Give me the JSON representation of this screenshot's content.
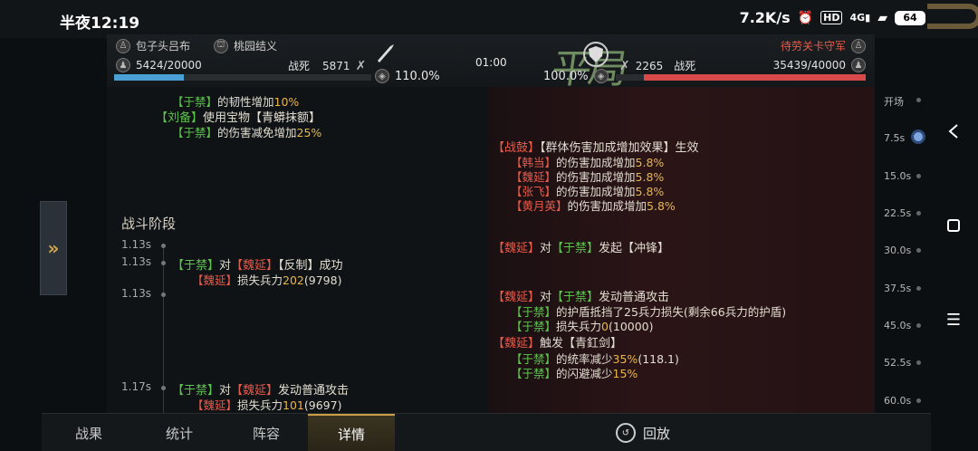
{
  "status_bar": {
    "time": "半夜12:19",
    "speed": "7.2K/s",
    "icons": [
      "alarm-icon",
      "hd-icon",
      "4g-signal-icon",
      "wifi-icon"
    ],
    "battery": "64"
  },
  "header": {
    "left_player": "包子头吕布",
    "left_alliance": "桃园结义",
    "left_hp": "5424/20000",
    "left_hp_fraction": 0.271,
    "left_dead_label": "战死",
    "left_dead": "5871",
    "left_pct": "110.0%",
    "timer": "01:00",
    "right_pct": "100.0%",
    "right_dead": "2265",
    "right_dead_label": "战死",
    "right_player": "待劳关卡守军",
    "right_hp": "35439/40000",
    "right_hp_fraction": 0.886,
    "title_art": "平局"
  },
  "log": {
    "section_title": "战斗阶段",
    "pre_lines": [
      {
        "a": "【于禁】",
        "b": "的韧性增加",
        "c": "10%"
      },
      {
        "a": "【刘备】",
        "b": "使用宝物【青蟒抹额】",
        "c": ""
      },
      {
        "a": "【于禁】",
        "b": "的伤害减免增加",
        "c": "25%"
      }
    ],
    "drum": {
      "a": "【战鼓】",
      "b": "【群体伤害加成增加效果】生效"
    },
    "drum_lines": [
      {
        "a": "【韩当】",
        "b": "的伤害加成增加",
        "c": "5.8%"
      },
      {
        "a": "【魏延】",
        "b": "的伤害加成增加",
        "c": "5.8%"
      },
      {
        "a": "【张飞】",
        "b": "的伤害加成增加",
        "c": "5.8%"
      },
      {
        "a": "【黄月英】",
        "b": "的伤害加成增加",
        "c": "5.8%"
      }
    ],
    "events": {
      "t1": "1.13s",
      "e1": {
        "a": "【魏延】",
        "b": "对",
        "c": "【于禁】",
        "d": "发起【冲锋】"
      },
      "t2": "1.13s",
      "e2": {
        "a": "【于禁】",
        "b": "对",
        "c": "【魏延】",
        "d": "【反制】成功"
      },
      "e2_sub": {
        "a": "【魏延】",
        "b": "损失兵力",
        "c": "202",
        "d": "(9798)"
      },
      "t3": "1.13s",
      "e3": {
        "a": "【魏延】",
        "b": "对",
        "c": "【于禁】",
        "d": "发动普通攻击"
      },
      "e3_sub1": {
        "a": "【于禁】",
        "b": "的护盾抵挡了25兵力损失(剩余66兵力的护盾)"
      },
      "e3_sub2": {
        "a": "【于禁】",
        "b": "损失兵力",
        "c": "0",
        "d": "(10000)"
      },
      "e3_trigger": {
        "a": "【魏延】",
        "b": "触发【青釭剑】"
      },
      "e3_sub3": {
        "a": "【于禁】",
        "b": "的统率减少",
        "c": "35%",
        "d": "(118.1)"
      },
      "e3_sub4": {
        "a": "【于禁】",
        "b": "的闪避减少",
        "c": "15%"
      },
      "t4": "1.17s",
      "e4": {
        "a": "【于禁】",
        "b": "对",
        "c": "【魏延】",
        "d": "发动普通攻击"
      },
      "e4_sub": {
        "a": "【魏延】",
        "b": "损失兵力",
        "c": "101",
        "d": "(9697)"
      }
    }
  },
  "timeline": [
    "开场",
    "7.5s",
    "15.0s",
    "22.5s",
    "30.0s",
    "37.5s",
    "45.0s",
    "52.5s",
    "60.0s"
  ],
  "tabs": [
    "战果",
    "统计",
    "阵容",
    "详情"
  ],
  "active_tab": "详情",
  "replay_label": "回放",
  "colors": {
    "ally": "#5ec24f",
    "enemy": "#e85a4a",
    "value": "#e8b84a",
    "ally_hp": "#4a9fd4",
    "enemy_hp": "#d84a4a"
  }
}
